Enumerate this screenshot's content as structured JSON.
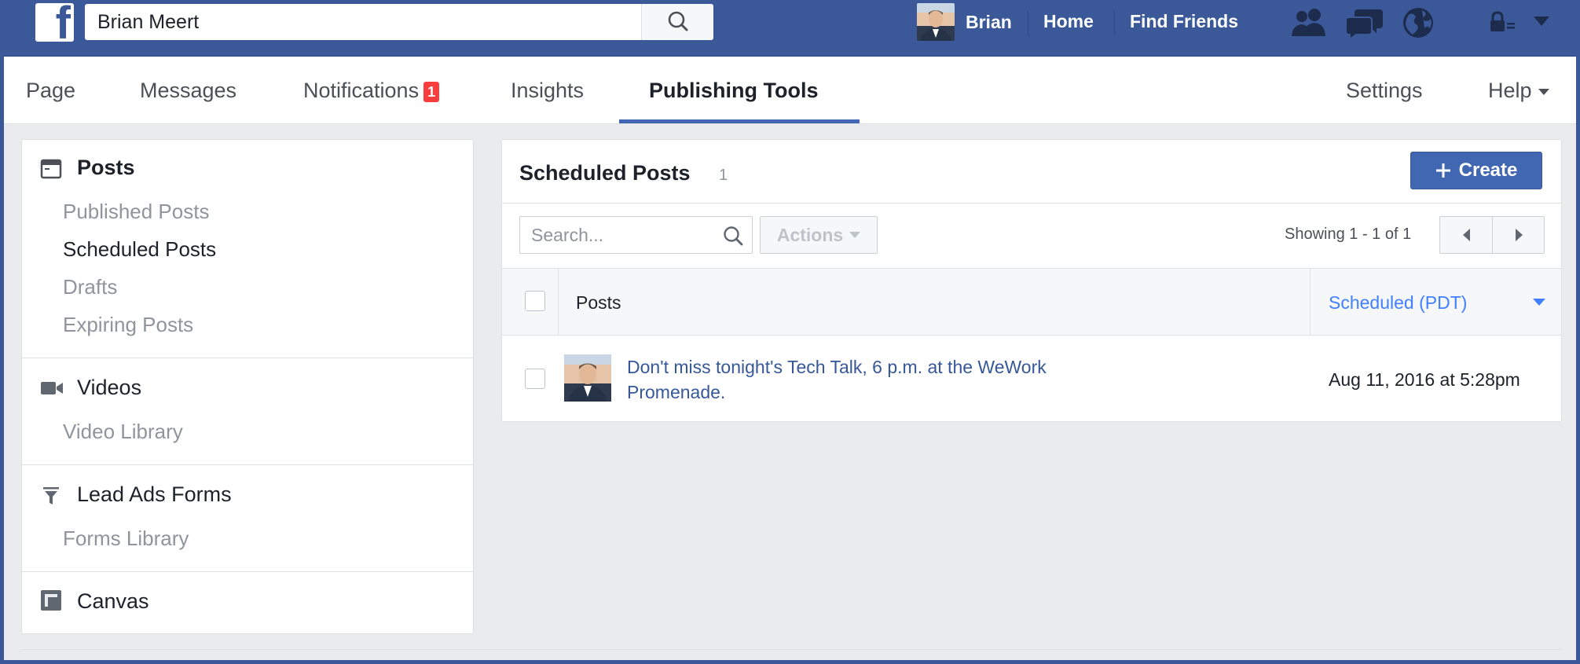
{
  "topbar": {
    "logo": "f",
    "search_value": "Brian Meert",
    "user_name": "Brian",
    "home": "Home",
    "find_friends": "Find Friends",
    "icons": [
      "friends-icon",
      "messages-icon",
      "globe-icon",
      "privacy-lock-icon",
      "account-caret-icon"
    ]
  },
  "tabs": {
    "page": "Page",
    "messages": "Messages",
    "notifications": "Notifications",
    "notifications_count": "1",
    "insights": "Insights",
    "publishing_tools": "Publishing Tools",
    "settings": "Settings",
    "help": "Help"
  },
  "sidebar": {
    "posts_heading": "Posts",
    "posts_items": [
      "Published Posts",
      "Scheduled Posts",
      "Drafts",
      "Expiring Posts"
    ],
    "videos_heading": "Videos",
    "videos_items": [
      "Video Library"
    ],
    "lead_heading": "Lead Ads Forms",
    "lead_items": [
      "Forms Library"
    ],
    "canvas_heading": "Canvas"
  },
  "main": {
    "title": "Scheduled Posts",
    "count": "1",
    "create_label": "Create",
    "search_placeholder": "Search...",
    "actions_label": "Actions",
    "showing": "Showing 1 - 1 of 1",
    "col_posts": "Posts",
    "col_scheduled": "Scheduled (PDT)",
    "rows": [
      {
        "text": "Don't miss tonight's Tech Talk, 6 p.m. at the WeWork Promenade.",
        "scheduled": "Aug 11, 2016 at 5:28pm"
      }
    ]
  },
  "colors": {
    "brand_blue": "#3b5998",
    "button_blue": "#4267b2",
    "link_blue": "#365899",
    "sort_blue": "#4080ff",
    "badge_red": "#fa3e3e"
  }
}
